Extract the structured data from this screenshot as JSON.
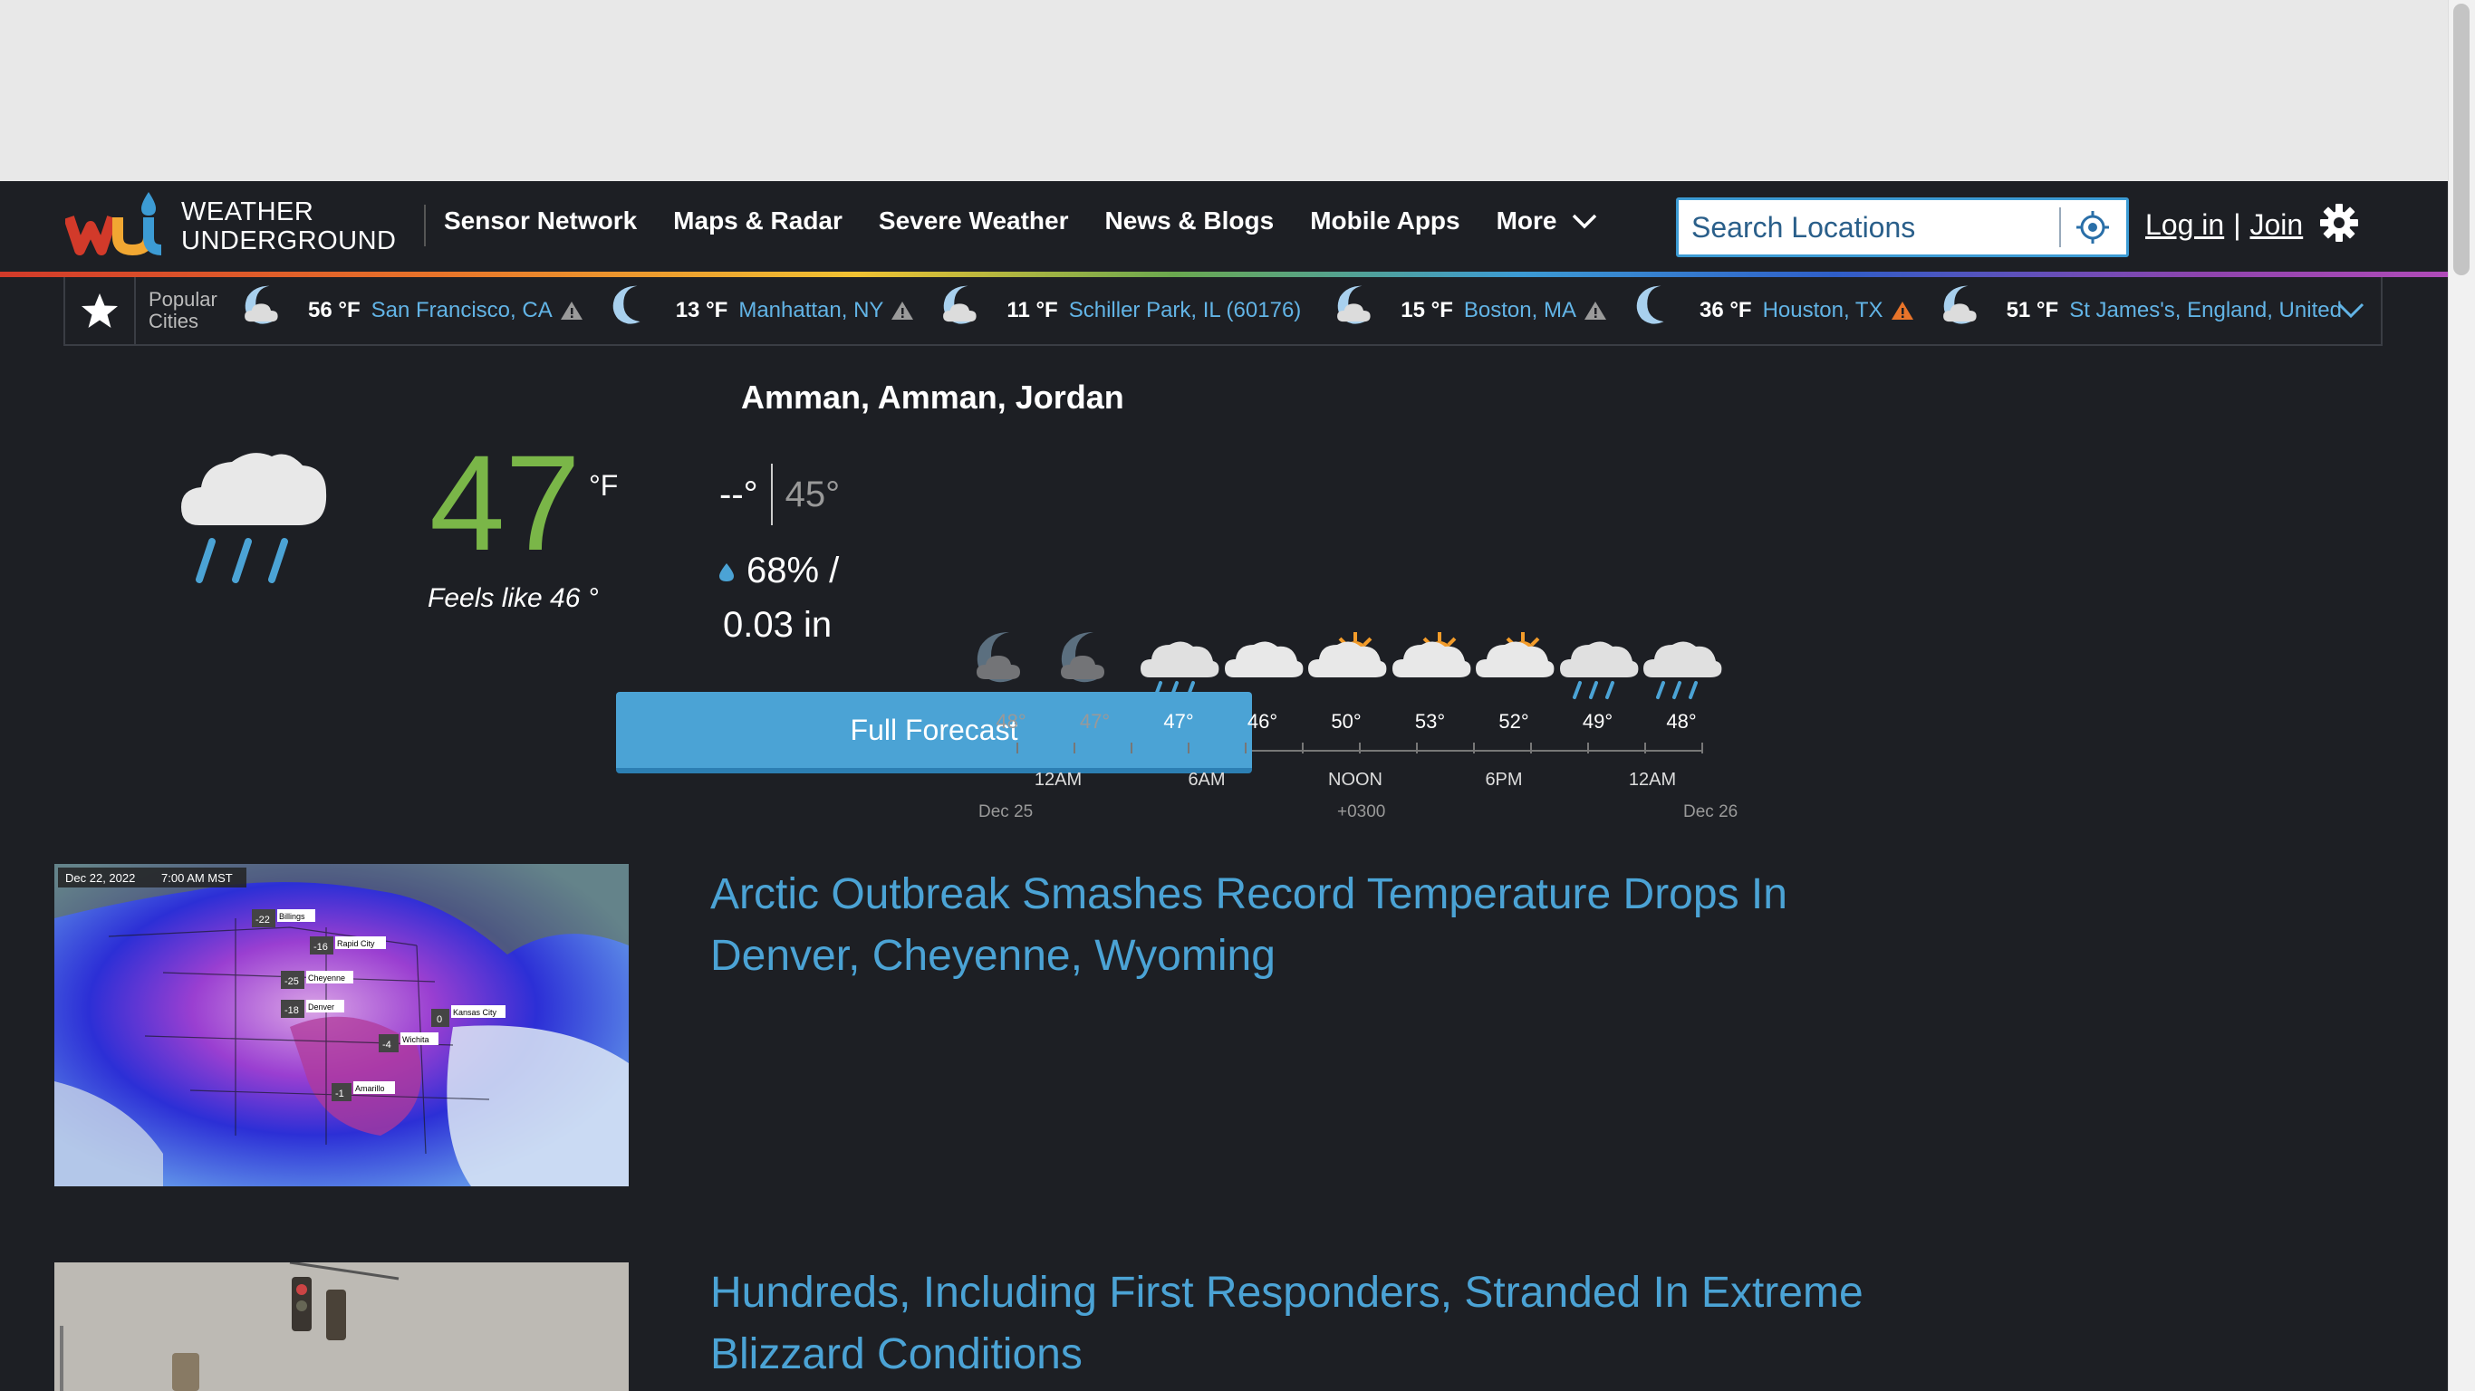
{
  "logo": {
    "line1": "WEATHER",
    "line2": "UNDERGROUND"
  },
  "nav": {
    "items": [
      "Sensor Network",
      "Maps & Radar",
      "Severe Weather",
      "News & Blogs",
      "Mobile Apps",
      "More"
    ]
  },
  "search": {
    "placeholder": "Search Locations"
  },
  "auth": {
    "login": "Log in",
    "separator": "|",
    "join": "Join"
  },
  "popular": {
    "label_line1": "Popular",
    "label_line2": "Cities",
    "cities": [
      {
        "temp": "56 °F",
        "name": "San Francisco, CA",
        "icon": "moon-cloud-icon",
        "alert": "gray"
      },
      {
        "temp": "13 °F",
        "name": "Manhattan, NY",
        "icon": "moon-icon",
        "alert": "gray"
      },
      {
        "temp": "11 °F",
        "name": "Schiller Park, IL (60176)",
        "icon": "moon-cloud-icon",
        "alert": ""
      },
      {
        "temp": "15 °F",
        "name": "Boston, MA",
        "icon": "moon-cloud-icon",
        "alert": "gray"
      },
      {
        "temp": "36 °F",
        "name": "Houston, TX",
        "icon": "moon-icon",
        "alert": "orange"
      },
      {
        "temp": "51 °F",
        "name": "St James's, England, United",
        "icon": "moon-cloud-icon",
        "alert": ""
      }
    ]
  },
  "current": {
    "location": "Amman, Amman, Jordan",
    "temp": "47",
    "unit": "°F",
    "feels_like": "Feels like 46 °",
    "high": "--°",
    "low": "45°",
    "precip_chance": "68% /",
    "precip_amount": "0.03 in",
    "icon": "rain-icon"
  },
  "hourly": {
    "temps": [
      "48°",
      "47°",
      "47°",
      "46°",
      "50°",
      "53°",
      "52°",
      "49°",
      "48°"
    ],
    "icons": [
      "moon-cloud-icon",
      "moon-cloud-icon",
      "rain-icon",
      "cloud-icon",
      "partly-sunny-icon",
      "partly-sunny-icon",
      "partly-sunny-icon",
      "rain-icon",
      "rain-icon"
    ],
    "past_count": 2,
    "ticks": [
      "12AM",
      "6AM",
      "NOON",
      "6PM",
      "12AM"
    ],
    "date_start": "Dec 25",
    "timezone": "+0300",
    "date_end": "Dec 26"
  },
  "full_forecast_label": "Full Forecast",
  "news": [
    {
      "title": "Arctic Outbreak Smashes Record Temperature Drops In Denver, Cheyenne, Wyoming",
      "thumb_date": "Dec 22, 2022",
      "thumb_time": "7:00 AM MST",
      "map_labels": [
        "Billings",
        "Rapid City",
        "Cheyenne",
        "Denver",
        "Kansas City",
        "Wichita",
        "Amarillo"
      ],
      "map_values": [
        "-22",
        "-16",
        "-25",
        "-18",
        "0",
        "-4",
        "-1"
      ]
    },
    {
      "title": "Hundreds, Including First Responders, Stranded In Extreme Blizzard Conditions"
    }
  ],
  "colors": {
    "accent": "#4ba3d5",
    "temp_green": "#7ab648",
    "link_blue": "#62b4e6",
    "background": "#1d1f24"
  }
}
